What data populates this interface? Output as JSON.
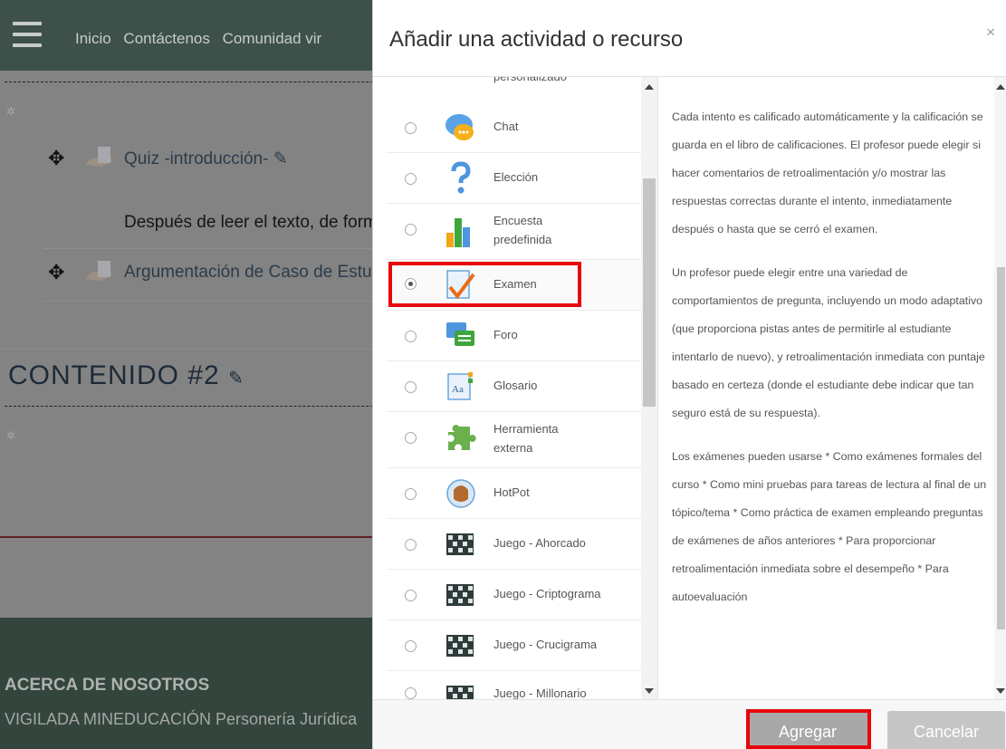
{
  "navbar": {
    "links": [
      "Inicio",
      "Contáctenos",
      "Comunidad vir"
    ]
  },
  "course": {
    "items": [
      {
        "label": "Quiz -introducción-"
      },
      {
        "label": "Argumentación de Caso de Estu"
      }
    ],
    "description": "Después de leer el texto, de form",
    "section_title": "CONTENIDO #2"
  },
  "footer": {
    "heading": "ACERCA DE NOSOTROS",
    "text": "VIGILADA MINEDUCACIÓN Personería Jurídica"
  },
  "modal": {
    "title": "Añadir una actividad o recurso",
    "close_glyph": "×",
    "partial_label": "personalizado",
    "options": [
      {
        "label": "Chat",
        "icon": "chat-icon",
        "selected": false
      },
      {
        "label": "Elección",
        "icon": "question-icon",
        "selected": false
      },
      {
        "label": "Encuesta predefinida",
        "icon": "bar-chart-icon",
        "selected": false
      },
      {
        "label": "Examen",
        "icon": "quiz-icon",
        "selected": true
      },
      {
        "label": "Foro",
        "icon": "forum-icon",
        "selected": false
      },
      {
        "label": "Glosario",
        "icon": "glossary-icon",
        "selected": false
      },
      {
        "label": "Herramienta externa",
        "icon": "puzzle-icon",
        "selected": false
      },
      {
        "label": "HotPot",
        "icon": "hotpot-icon",
        "selected": false
      },
      {
        "label": "Juego - Ahorcado",
        "icon": "game-grid-icon",
        "selected": false
      },
      {
        "label": "Juego - Criptograma",
        "icon": "game-grid-icon",
        "selected": false
      },
      {
        "label": "Juego - Crucigrama",
        "icon": "game-grid-icon",
        "selected": false
      },
      {
        "label": "Juego - Millonario",
        "icon": "game-grid-icon",
        "selected": false
      }
    ],
    "description": [
      "Cada intento es calificado automáticamente y la calificación se guarda en el libro de calificaciones. El profesor puede elegir si hacer comentarios de retroalimentación y/o mostrar las respuestas correctas durante el intento, inmediatamente después o hasta que se cerró el examen.",
      "Un profesor puede elegir entre una variedad de comportamientos de pregunta, incluyendo un modo adaptativo (que proporciona pistas antes de permitirle al estudiante intentarlo de nuevo), y retroalimentación inmediata con puntaje basado en certeza (donde el estudiante debe indicar que tan seguro está de su respuesta).",
      "Los exámenes pueden usarse * Como exámenes formales del curso * Como mini pruebas para tareas de lectura al final de un tópico/tema * Como práctica de examen empleando preguntas de exámenes de años anteriores * Para proporcionar retroalimentación inmediata sobre el desempeño * Para autoevaluación"
    ],
    "buttons": {
      "add": "Agregar",
      "cancel": "Cancelar"
    }
  },
  "colors": {
    "navbar": "#3d514a",
    "footer": "#33453d",
    "highlight": "#e8050b"
  }
}
